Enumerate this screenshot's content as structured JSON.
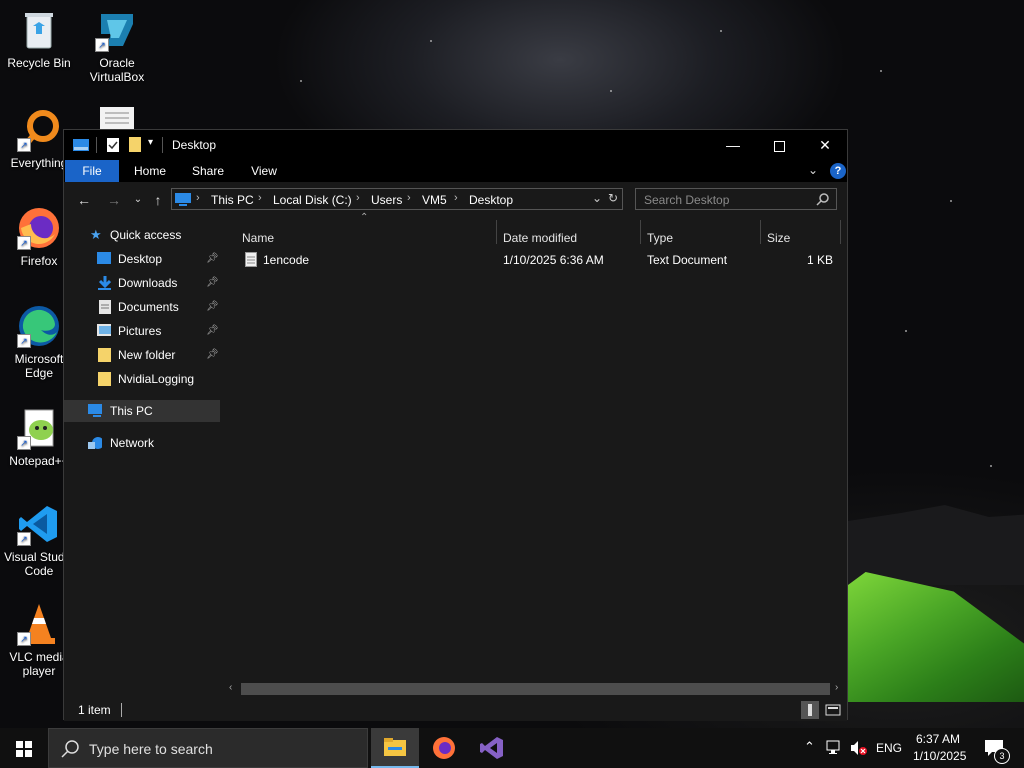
{
  "desktop": {
    "icons": [
      {
        "label": "Recycle Bin"
      },
      {
        "label": "Oracle VirtualBox"
      },
      {
        "label": "Everything"
      },
      {
        "label": "Firefox"
      },
      {
        "label": "Microsoft Edge"
      },
      {
        "label": "Notepad++"
      },
      {
        "label": "Visual Studio Code"
      },
      {
        "label": "VLC media player"
      }
    ]
  },
  "window": {
    "title": "Desktop",
    "ribbon_tabs": [
      "File",
      "Home",
      "Share",
      "View"
    ],
    "breadcrumbs": [
      "This PC",
      "Local Disk (C:)",
      "Users",
      "VM5",
      "Desktop"
    ],
    "search_placeholder": "Search Desktop",
    "nav": {
      "quick_access": "Quick access",
      "items": [
        {
          "label": "Desktop",
          "pinned": true
        },
        {
          "label": "Downloads",
          "pinned": true
        },
        {
          "label": "Documents",
          "pinned": true
        },
        {
          "label": "Pictures",
          "pinned": true
        },
        {
          "label": "New folder",
          "pinned": true
        },
        {
          "label": "NvidiaLogging",
          "pinned": false
        }
      ],
      "this_pc": "This PC",
      "network": "Network"
    },
    "columns": [
      "Name",
      "Date modified",
      "Type",
      "Size"
    ],
    "files": [
      {
        "name": "1encode",
        "date": "1/10/2025 6:36 AM",
        "type": "Text Document",
        "size": "1 KB"
      }
    ],
    "status": "1 item"
  },
  "taskbar": {
    "search_placeholder": "Type here to search",
    "language": "ENG",
    "time": "6:37 AM",
    "date": "1/10/2025",
    "notifications": "3"
  },
  "colors": {
    "accent": "#1a64c8",
    "window_bg": "#191919",
    "titlebar": "#000000"
  }
}
